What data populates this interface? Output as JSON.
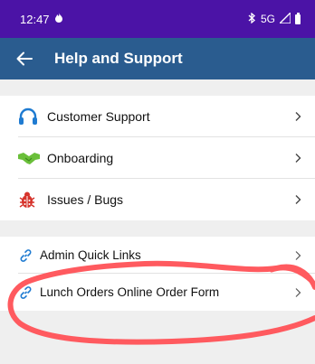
{
  "status_bar": {
    "time": "12:47",
    "network": "5G"
  },
  "app_bar": {
    "title": "Help and Support"
  },
  "group1": {
    "items": [
      {
        "label": "Customer Support",
        "icon": "headphones-icon"
      },
      {
        "label": "Onboarding",
        "icon": "handshake-icon"
      },
      {
        "label": "Issues / Bugs",
        "icon": "bug-icon"
      }
    ]
  },
  "group2": {
    "items": [
      {
        "label": "Admin Quick Links",
        "icon": "link-icon"
      },
      {
        "label": "Lunch Orders Online Order Form",
        "icon": "link-icon"
      }
    ]
  },
  "colors": {
    "status_bar": "#4b13a6",
    "app_bar": "#2a5c8f",
    "background": "#efefef",
    "annotation": "#ff5a5f"
  }
}
